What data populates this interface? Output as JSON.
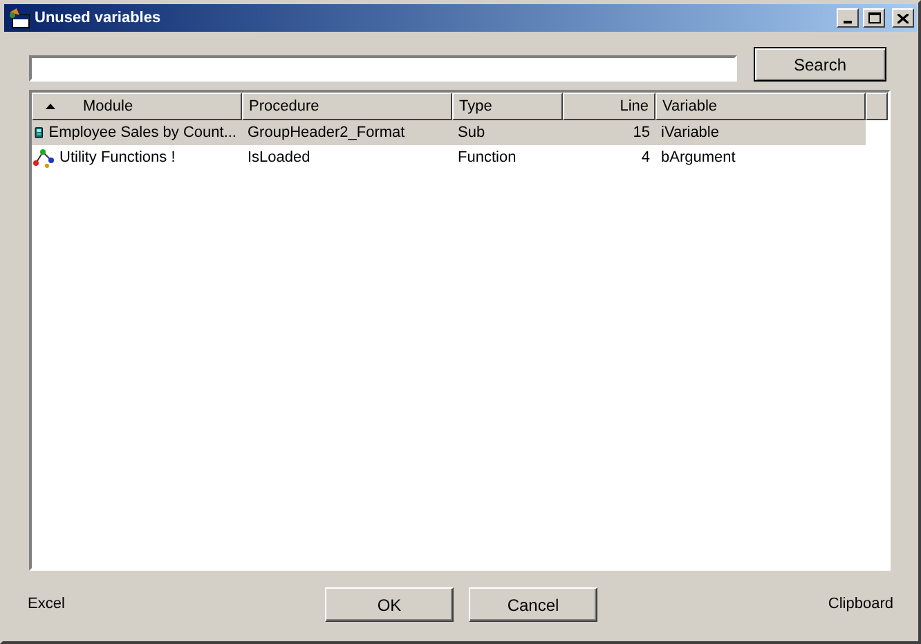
{
  "window": {
    "title": "Unused variables"
  },
  "search": {
    "button": "Search"
  },
  "table": {
    "columns": [
      {
        "label": "Module",
        "sorted": true
      },
      {
        "label": "Procedure",
        "sorted": false
      },
      {
        "label": "Type",
        "sorted": false
      },
      {
        "label": "Line",
        "sorted": false
      },
      {
        "label": "Variable",
        "sorted": false
      }
    ],
    "rows": [
      {
        "kind": "report",
        "selected": true,
        "cells": [
          "Employee Sales by Count...",
          "GroupHeader2_Format",
          "Sub",
          "15",
          "iVariable"
        ]
      },
      {
        "kind": "module",
        "selected": false,
        "cells": [
          "Utility Functions !",
          "IsLoaded",
          "Function",
          "4",
          "bArgument"
        ]
      }
    ]
  },
  "footer": {
    "left_link": "Excel",
    "buttons": [
      "OK",
      "Cancel"
    ],
    "right_link": "Clipboard"
  }
}
